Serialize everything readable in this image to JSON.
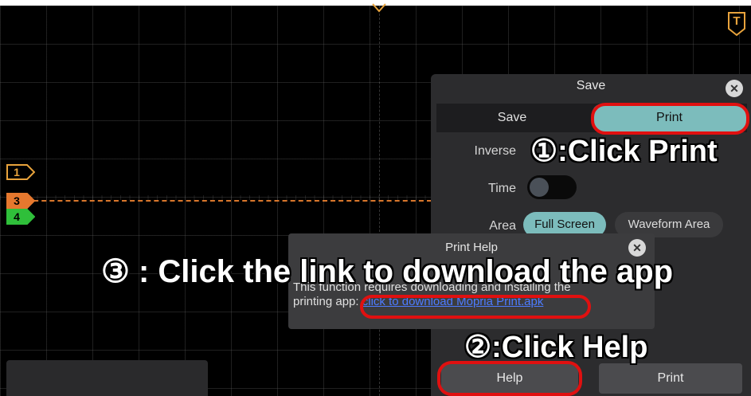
{
  "colors": {
    "accent_teal": "#7cbcbc",
    "highlight_red": "#e01010",
    "ch1": "#e8a33c",
    "ch3": "#e6782e",
    "ch4": "#2fbf3a",
    "link": "#4d7bff"
  },
  "markers": {
    "ch1": "1",
    "ch3": "3",
    "ch4": "4",
    "trigger": "T"
  },
  "save_dialog": {
    "title": "Save",
    "close_icon": "close-icon",
    "tabs": [
      "Save",
      "Print"
    ],
    "active_tab": "Print",
    "inverse_label": "Inverse",
    "time_label": "Time",
    "time_enabled": false,
    "area_label": "Area",
    "area_options": [
      "Full Screen",
      "Waveform Area"
    ],
    "area_selected": "Full Screen",
    "help_button": "Help",
    "print_button": "Print"
  },
  "help_dialog": {
    "title": "Print Help",
    "text_line1": "This function requires downloading and installing the",
    "text_line2_prefix": "printing app: ",
    "link_text": "click to download Mopria Print.apk"
  },
  "annotations": {
    "step1": "①:Click Print",
    "step2": "②:Click Help",
    "step3": "③ : Click the link to download the app"
  }
}
